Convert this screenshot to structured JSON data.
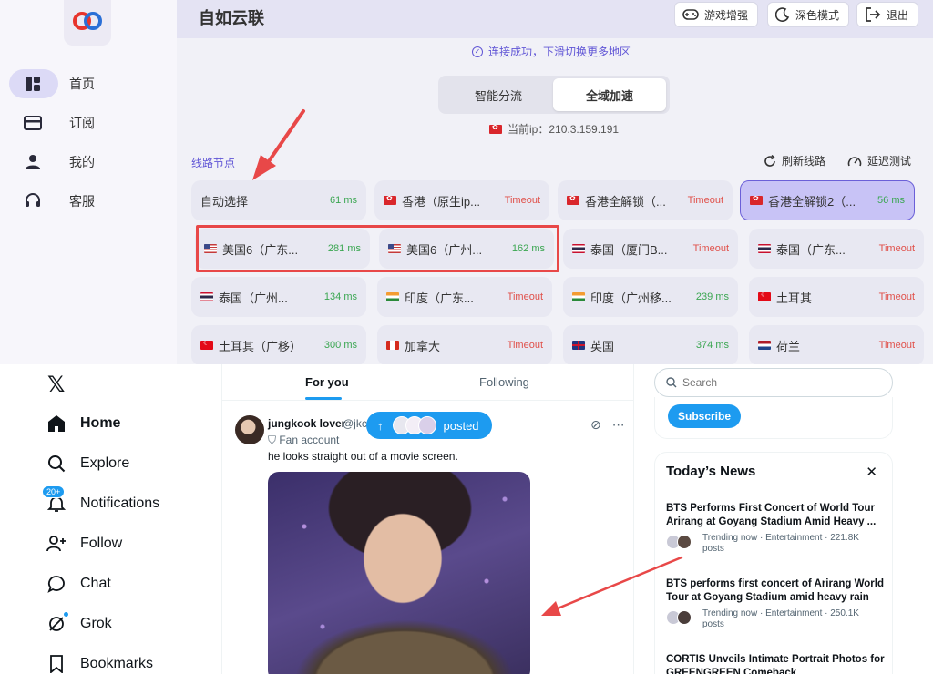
{
  "vpn": {
    "title": "自如云联",
    "nav": [
      {
        "label": "首页",
        "icon": "dashboard-icon",
        "active": true
      },
      {
        "label": "订阅",
        "icon": "card-icon",
        "active": false
      },
      {
        "label": "我的",
        "icon": "user-icon",
        "active": false
      },
      {
        "label": "客服",
        "icon": "headset-icon",
        "active": false
      }
    ],
    "header_buttons": {
      "game": "游戏增强",
      "dark": "深色模式",
      "logout": "退出"
    },
    "connection_message": "连接成功，下滑切换更多地区",
    "modes": {
      "smart": "智能分流",
      "global": "全域加速",
      "active": "global"
    },
    "current_ip": "当前ip：210.3.159.191",
    "section_label": "线路节点",
    "refresh_label": "刷新线路",
    "latency_test_label": "延迟测试",
    "nodes": [
      {
        "name": "自动选择",
        "flag": "",
        "latency": "61 ms"
      },
      {
        "name": "香港（原生ip...",
        "flag": "hk",
        "latency": "Timeout"
      },
      {
        "name": "香港全解锁（...",
        "flag": "hk",
        "latency": "Timeout"
      },
      {
        "name": "香港全解锁2（...",
        "flag": "hk",
        "latency": "56 ms",
        "selected": true
      },
      {
        "name": "美国6（广东...",
        "flag": "us",
        "latency": "281 ms"
      },
      {
        "name": "美国6（广州...",
        "flag": "us",
        "latency": "162 ms"
      },
      {
        "name": "泰国（厦门B...",
        "flag": "th",
        "latency": "Timeout"
      },
      {
        "name": "泰国（广东...",
        "flag": "th",
        "latency": "Timeout"
      },
      {
        "name": "泰国（广州...",
        "flag": "th",
        "latency": "134 ms"
      },
      {
        "name": "印度（广东...",
        "flag": "in",
        "latency": "Timeout"
      },
      {
        "name": "印度（广州移...",
        "flag": "in",
        "latency": "239 ms"
      },
      {
        "name": "土耳其",
        "flag": "tr",
        "latency": "Timeout"
      },
      {
        "name": "土耳其（广移）",
        "flag": "tr",
        "latency": "300 ms"
      },
      {
        "name": "加拿大",
        "flag": "ca",
        "latency": "Timeout"
      },
      {
        "name": "英国",
        "flag": "gb",
        "latency": "374 ms"
      },
      {
        "name": "荷兰",
        "flag": "nl",
        "latency": "Timeout"
      }
    ],
    "colors": {
      "accent": "#6156d6",
      "ok": "#3aa651",
      "timeout": "#e0504a",
      "annotation": "#e84848"
    }
  },
  "x": {
    "logo": "𝕏",
    "nav": [
      {
        "label": "Home",
        "icon": "home-icon",
        "active": true
      },
      {
        "label": "Explore",
        "icon": "search-icon"
      },
      {
        "label": "Notifications",
        "icon": "bell-icon",
        "badge": "20+"
      },
      {
        "label": "Follow",
        "icon": "add-person-icon"
      },
      {
        "label": "Chat",
        "icon": "chat-bubble-icon"
      },
      {
        "label": "Grok",
        "icon": "grok-icon"
      },
      {
        "label": "Bookmarks",
        "icon": "bookmark-icon"
      }
    ],
    "tabs": {
      "for_you": "For you",
      "following": "Following",
      "active": "for_you"
    },
    "posted_pill": "posted",
    "tweet": {
      "name": "jungkook lover",
      "handle": "@jkc",
      "fan_label": "Fan account",
      "text": "he looks straight out of a movie screen."
    },
    "search_placeholder": "Search",
    "subscribe_label": "Subscribe",
    "news": {
      "title": "Today’s News",
      "items": [
        {
          "headline": "BTS Performs First Concert of World Tour Arirang at Goyang Stadium Amid Heavy ...",
          "meta": "Trending now · Entertainment · 221.8K",
          "posts": "posts"
        },
        {
          "headline": "BTS performs first concert of Arirang World Tour at Goyang Stadium amid heavy rain",
          "meta": "Trending now · Entertainment · 250.1K",
          "posts": "posts"
        },
        {
          "headline": "CORTIS Unveils Intimate Portrait Photos for GREENGREEN Comeback",
          "meta": "",
          "posts": ""
        }
      ]
    },
    "colors": {
      "accent": "#1d9bf0",
      "text": "#0f1419",
      "muted": "#536471"
    }
  }
}
